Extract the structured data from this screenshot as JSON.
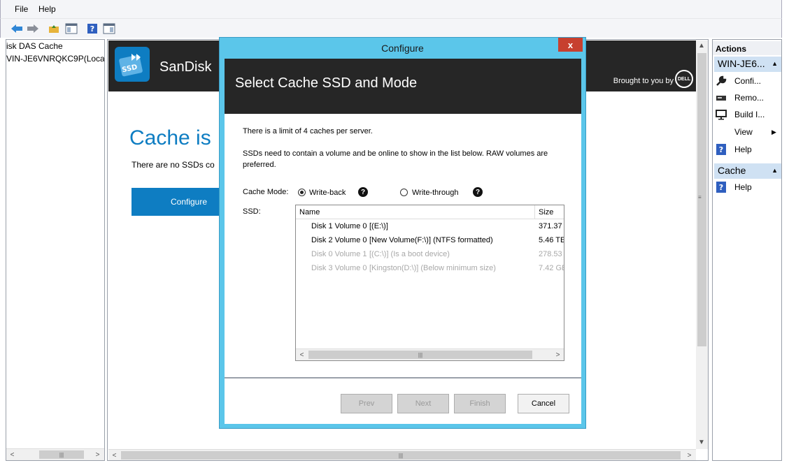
{
  "menubar": {
    "file": "File",
    "help": "Help"
  },
  "tree": {
    "items": [
      "isk DAS Cache",
      "VIN-JE6VNRQKC9P(Local)"
    ]
  },
  "banner": {
    "brand": "SanDisk",
    "brought_by": "Brought to you by",
    "dell": "DELL",
    "logo_text": "SSD"
  },
  "main": {
    "heading": "Cache is",
    "no_ssd_text": "There are no SSDs co",
    "configure_label": "Configure"
  },
  "actions": {
    "title": "Actions",
    "server_section": "WIN-JE6...",
    "server_items": [
      {
        "label": "Confi...",
        "icon": "wrench-icon"
      },
      {
        "label": "Remo...",
        "icon": "drive-icon"
      },
      {
        "label": "Build I...",
        "icon": "monitor-icon"
      },
      {
        "label": "View",
        "icon": ""
      },
      {
        "label": "Help",
        "icon": "help-icon"
      }
    ],
    "cache_section": "Cache",
    "cache_items": [
      {
        "label": "Help",
        "icon": "help-icon"
      }
    ]
  },
  "dialog": {
    "title": "Configure",
    "close": "x",
    "header": "Select Cache SSD and Mode",
    "limit_text": "There is a limit of 4 caches per server.",
    "ssd_note_line1": "SSDs need to contain a volume and be online to show in the list below.  RAW volumes are",
    "ssd_note_line2": "preferred.",
    "cache_mode_label": "Cache Mode:",
    "mode_writeback": "Write-back",
    "mode_writethrough": "Write-through",
    "selected_mode": "Write-back",
    "ssd_label": "SSD:",
    "columns": {
      "name": "Name",
      "size": "Size"
    },
    "rows": [
      {
        "disk": "Disk 1 Volume 0",
        "desc": "[(E:\\)]",
        "size": "371.37",
        "enabled": true
      },
      {
        "disk": "Disk 2 Volume 0",
        "desc": "[New Volume(F:\\)] (NTFS formatted)",
        "size": "5.46 TE",
        "enabled": true
      },
      {
        "disk": "Disk 0 Volume 1",
        "desc": "[(C:\\)] (Is a boot device)",
        "size": "278.53",
        "enabled": false
      },
      {
        "disk": "Disk 3 Volume 0",
        "desc": "[Kingston(D:\\)] (Below minimum size)",
        "size": "7.42 GE",
        "enabled": false
      }
    ],
    "buttons": {
      "prev": "Prev",
      "next": "Next",
      "finish": "Finish",
      "cancel": "Cancel"
    }
  },
  "colors": {
    "accent": "#0e7dc2",
    "dialog_frame": "#5bc6ea",
    "banner": "#262626",
    "close": "#c7402f"
  }
}
